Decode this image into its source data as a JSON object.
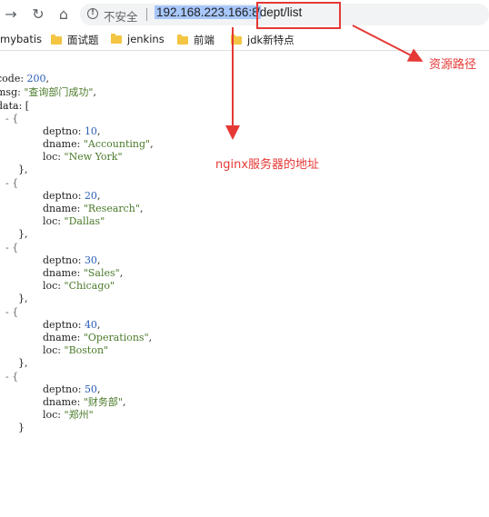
{
  "toolbar": {
    "insecure_label": "不安全",
    "url_host": "192.168.223.166:8",
    "url_path": "/dept/list"
  },
  "bookmarks": [
    {
      "label": "mybatis",
      "folder": false
    },
    {
      "label": "面试题",
      "folder": true
    },
    {
      "label": "jenkins",
      "folder": true
    },
    {
      "label": "前端",
      "folder": true
    },
    {
      "label": "jdk新特点",
      "folder": true
    }
  ],
  "json_view": {
    "code_key": "code",
    "code_value": "200",
    "msg_key": "msg",
    "msg_value": "\"查询部门成功\"",
    "data_key": "data",
    "items": [
      {
        "deptno": "10",
        "dname": "\"Accounting\"",
        "loc": "\"New York\""
      },
      {
        "deptno": "20",
        "dname": "\"Research\"",
        "loc": "\"Dallas\""
      },
      {
        "deptno": "30",
        "dname": "\"Sales\"",
        "loc": "\"Chicago\""
      },
      {
        "deptno": "40",
        "dname": "\"Operations\"",
        "loc": "\"Boston\""
      },
      {
        "deptno": "50",
        "dname": "\"财务部\"",
        "loc": "\"郑州\""
      }
    ]
  },
  "annotations": {
    "resource_path": "资源路径",
    "nginx_address": "nginx服务器的地址"
  },
  "colors": {
    "annotation_red": "#e53935",
    "url_highlight": "#a8c7fa"
  }
}
